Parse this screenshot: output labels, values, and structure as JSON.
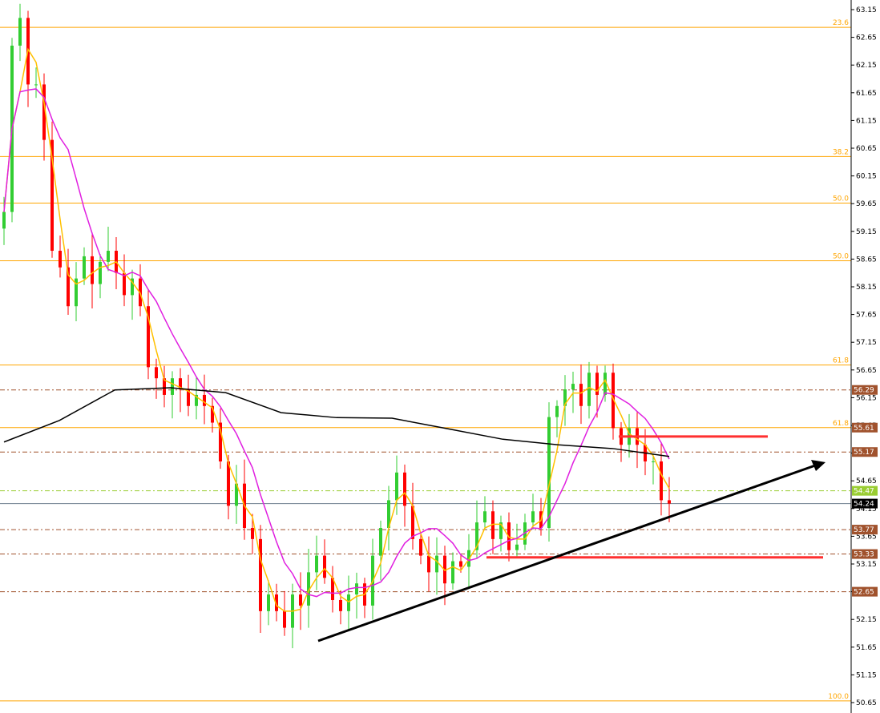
{
  "chart_data": {
    "type": "candlestick",
    "title": "",
    "ylim": [
      50.65,
      63.15
    ],
    "y_ticks": [
      "63.15",
      "62.65",
      "62.15",
      "61.65",
      "61.15",
      "60.65",
      "60.15",
      "59.65",
      "59.15",
      "58.65",
      "58.15",
      "57.65",
      "57.15",
      "56.65",
      "56.15",
      "55.65",
      "55.15",
      "54.65",
      "54.15",
      "53.65",
      "53.15",
      "52.65",
      "52.15",
      "51.65",
      "51.15",
      "50.65"
    ],
    "closes": [
      59.5,
      62.5,
      63.0,
      61.8,
      61.8,
      60.8,
      58.8,
      58.5,
      57.8,
      58.3,
      58.7,
      58.2,
      58.6,
      58.8,
      58.4,
      58.0,
      58.3,
      57.8,
      56.7,
      56.5,
      56.2,
      56.5,
      56.3,
      56.0,
      56.2,
      56.0,
      55.7,
      55.0,
      54.2,
      54.6,
      53.8,
      53.6,
      52.3,
      52.6,
      52.3,
      52.0,
      52.6,
      52.4,
      53.0,
      53.3,
      52.9,
      52.5,
      52.3,
      52.6,
      52.8,
      52.4,
      53.3,
      53.8,
      54.3,
      54.8,
      54.2,
      53.6,
      53.3,
      53.0,
      53.3,
      52.8,
      53.2,
      53.1,
      53.4,
      53.9,
      54.1,
      53.6,
      53.9,
      53.4,
      53.5,
      53.9,
      54.1,
      53.8,
      55.8,
      56.0,
      56.3,
      56.4,
      56.0,
      56.6,
      56.2,
      56.6,
      55.6,
      55.3,
      55.6,
      55.3,
      55.0,
      55.0,
      54.3,
      54.24
    ],
    "long_ma": [
      55.35,
      55.74,
      56.29,
      56.33,
      56.24,
      55.88,
      55.79,
      55.78,
      55.59,
      55.4,
      55.3,
      55.23,
      55.09
    ],
    "fib_levels": [
      {
        "label": "23.6",
        "price": 62.83
      },
      {
        "label": "38.2",
        "price": 60.5
      },
      {
        "label": "50.0",
        "price": 59.66
      },
      {
        "label": "50.0",
        "price": 58.62
      },
      {
        "label": "61.8",
        "price": 56.74
      },
      {
        "label": "61.8",
        "price": 55.61
      },
      {
        "label": "100.0",
        "price": 50.68
      }
    ],
    "levels": [
      {
        "label": "56.29",
        "price": 56.29,
        "color": "#a0522d"
      },
      {
        "label": "55.61",
        "price": 55.61,
        "color": "#a0522d",
        "no_line": true
      },
      {
        "label": "55.17",
        "price": 55.17,
        "color": "#a0522d"
      },
      {
        "label": "54.47",
        "price": 54.47,
        "color": "#9acd32"
      },
      {
        "label": "53.77",
        "price": 53.77,
        "color": "#a0522d"
      },
      {
        "label": "53.33",
        "price": 53.33,
        "color": "#a0522d"
      },
      {
        "label": "52.65",
        "price": 52.65,
        "color": "#a0522d"
      }
    ],
    "current_price": {
      "label": "54.24",
      "price": 54.24
    },
    "resistance_segment_price": 55.45,
    "support_segment_price": 53.27,
    "colors": {
      "bull": "#32cd32",
      "bear": "#ff0000",
      "fast_ma": "#ffc000",
      "slow_ma": "#e020e0",
      "long_ma": "#000000",
      "fib": "#ffa500",
      "red_line": "#ff3030"
    }
  }
}
